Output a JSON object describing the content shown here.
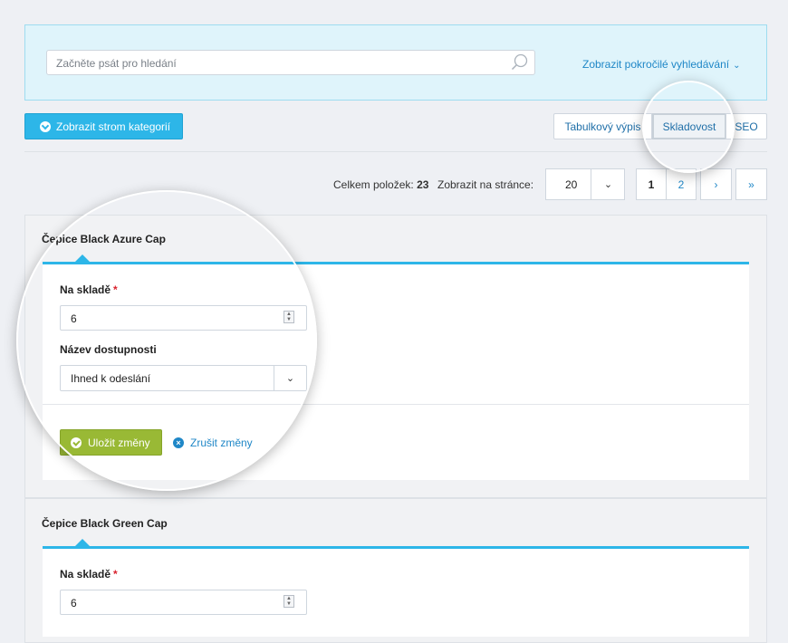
{
  "search": {
    "placeholder": "Začněte psát pro hledání",
    "advanced_label": "Zobrazit pokročilé vyhledávání"
  },
  "toolbar": {
    "category_tree_label": "Zobrazit strom kategorií",
    "view_tabs": [
      {
        "label": "Tabulkový výpis",
        "active": false
      },
      {
        "label": "Skladovost",
        "active": true
      },
      {
        "label": "SEO",
        "active": false
      }
    ]
  },
  "pagination": {
    "total_label": "Celkem položek:",
    "total_count": "23",
    "per_page_label": "Zobrazit na stránce:",
    "per_page_value": "20",
    "pages": [
      "1",
      "2"
    ],
    "current_page": "1",
    "next_label": "›",
    "last_label": "»"
  },
  "products": [
    {
      "title": "Čepice Black Azure Cap",
      "stock_label": "Na skladě",
      "required_mark": "*",
      "stock_value": "6",
      "availability_label": "Název dostupnosti",
      "availability_value": "Ihned k odeslání",
      "save_label": "Uložit změny",
      "cancel_label": "Zrušit změny"
    },
    {
      "title": "Čepice Black Green Cap",
      "stock_label": "Na skladě",
      "required_mark": "*",
      "stock_value": "6"
    }
  ],
  "colors": {
    "accent": "#2db6e8",
    "link": "#1f87c7",
    "save_button": "#99b935",
    "search_panel_bg": "#dff4fb",
    "required": "#d9232e"
  }
}
